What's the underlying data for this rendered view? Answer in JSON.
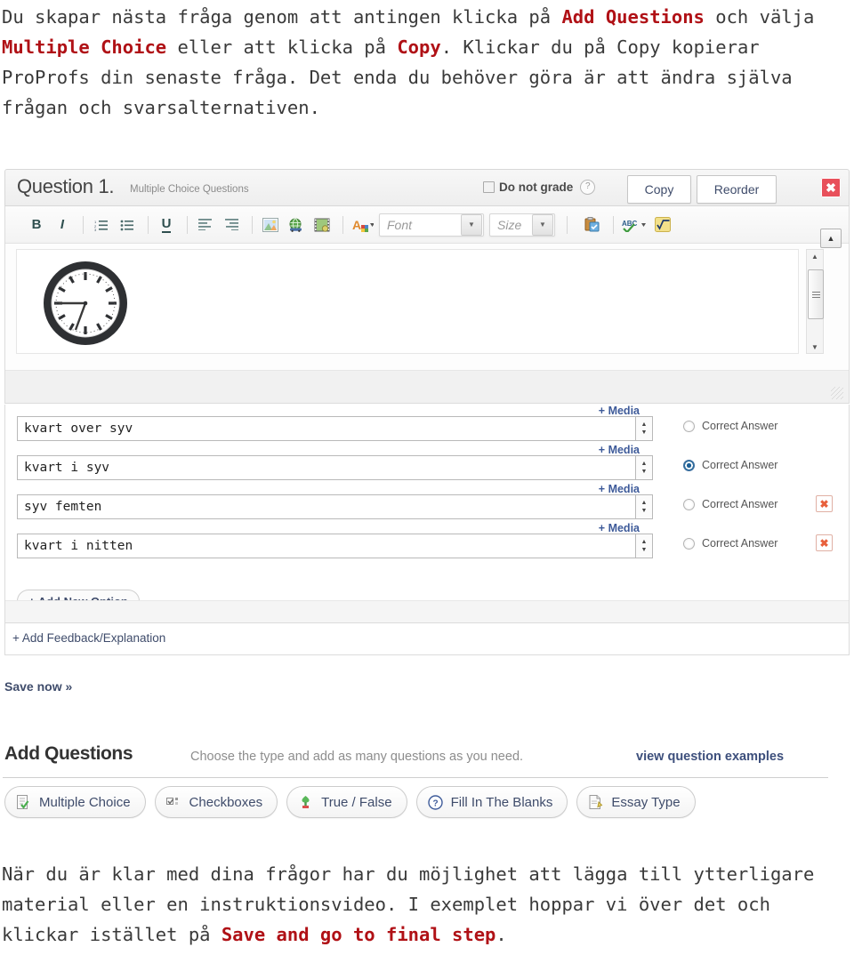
{
  "top_paragraph": {
    "segments": [
      {
        "text": "Du skapar nästa fråga genom att antingen klicka på ",
        "hl": false
      },
      {
        "text": "Add Questions",
        "hl": true
      },
      {
        "text": " och välja ",
        "hl": false
      },
      {
        "text": "Multiple Choice",
        "hl": true
      },
      {
        "text": " eller att klicka på ",
        "hl": false
      },
      {
        "text": "Copy",
        "hl": true
      },
      {
        "text": ". Klickar du på Copy kopierar ProProfs din senaste fråga. Det enda du behöver göra är att ändra själva frågan och svarsalternativen.",
        "hl": false
      }
    ]
  },
  "bottom_paragraph": {
    "segments": [
      {
        "text": "När du är klar med dina frågor har du möjlighet att lägga till ytterligare material eller en instruktionsvideo. I exemplet hoppar vi över det och klickar istället på ",
        "hl": false
      },
      {
        "text": "Save and go to final step",
        "hl": true
      },
      {
        "text": ".",
        "hl": false
      }
    ]
  },
  "question_header": {
    "title": "Question 1.",
    "subtitle": "Multiple Choice Questions",
    "do_not_grade_label": "Do not grade",
    "do_not_grade_checked": false,
    "help_icon": "question-mark-icon",
    "copy_label": "Copy",
    "reorder_label": "Reorder",
    "close_label": "✖"
  },
  "toolbar": {
    "buttons": [
      {
        "name": "bold-icon",
        "glyph": "B"
      },
      {
        "name": "italic-icon",
        "glyph": "I"
      },
      {
        "name": "ordered-list-icon",
        "glyph": "list-ol"
      },
      {
        "name": "unordered-list-icon",
        "glyph": "list-ul"
      },
      {
        "name": "underline-icon",
        "glyph": "U"
      },
      {
        "name": "align-left-icon",
        "glyph": "align-left"
      },
      {
        "name": "align-right-icon",
        "glyph": "align-right"
      },
      {
        "name": "insert-image-icon",
        "glyph": "image"
      },
      {
        "name": "insert-link-icon",
        "glyph": "globe"
      },
      {
        "name": "insert-video-icon",
        "glyph": "film"
      },
      {
        "name": "font-color-icon",
        "glyph": "A-color"
      }
    ],
    "font_placeholder": "Font",
    "size_placeholder": "Size",
    "paste_icon": "paste-icon",
    "spellcheck_icon": "spellcheck-abc-icon",
    "math_icon": "math-sqrt-icon"
  },
  "editor": {
    "content_icon": "clock-image",
    "scroll_up_label": "▲",
    "scroll_down_label": "▼",
    "resize_grip": "resize-grip-icon"
  },
  "options": {
    "media_label": "+ Media",
    "correct_answer_label": "Correct Answer",
    "add_option_label": "+ Add New Option",
    "delete_label": "✖",
    "items": [
      {
        "text": "kvart over syv",
        "correct": false,
        "deletable": false
      },
      {
        "text": "kvart i syv",
        "correct": true,
        "deletable": false
      },
      {
        "text": "syv femten",
        "correct": false,
        "deletable": true
      },
      {
        "text": "kvart i nitten",
        "correct": false,
        "deletable": true
      }
    ]
  },
  "feedback": {
    "add_feedback_label": "+ Add Feedback/Explanation"
  },
  "save_now_label": "Save now »",
  "add_questions": {
    "title": "Add Questions",
    "subtitle": "Choose the type and add as many questions as you need.",
    "examples_link": "view question examples",
    "types": [
      {
        "label": "Multiple Choice",
        "icon": "multiple-choice-icon"
      },
      {
        "label": "Checkboxes",
        "icon": "checkboxes-icon"
      },
      {
        "label": "True / False",
        "icon": "true-false-icon"
      },
      {
        "label": "Fill In The Blanks",
        "icon": "fill-in-blanks-icon"
      },
      {
        "label": "Essay Type",
        "icon": "essay-type-icon"
      }
    ]
  },
  "colors": {
    "highlight_red": "#b01116",
    "link_blue": "#3f4c6b",
    "close_red": "#e8505b",
    "radio_blue": "#1c5f96"
  }
}
